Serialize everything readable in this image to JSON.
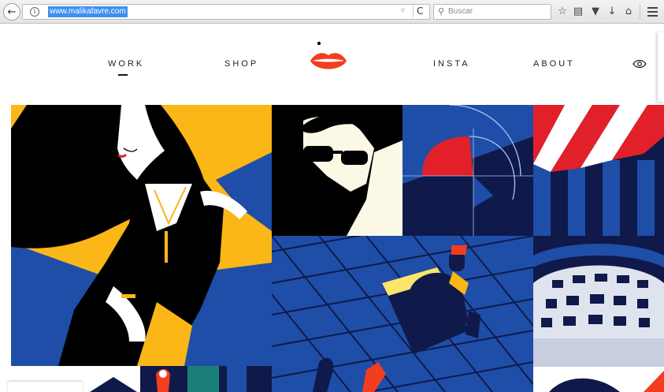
{
  "browser": {
    "url": "www.malikafavre.com",
    "search_placeholder": "Buscar",
    "icons": {
      "back": "back-arrow-icon",
      "info": "info-icon",
      "reload": "reload-icon",
      "search": "search-icon",
      "bookmark": "bookmark-star-icon",
      "reading_list": "reading-list-icon",
      "pocket": "pocket-icon",
      "downloads": "download-icon",
      "home": "home-icon",
      "menu": "hamburger-menu-icon"
    }
  },
  "site": {
    "nav": {
      "work": "WORK",
      "shop": "SHOP",
      "insta": "INSTA",
      "about": "ABOUT"
    },
    "active_nav": "work",
    "logo": "red-lips-logo",
    "colors": {
      "lips": "#f23d1e",
      "navy": "#0f1a4a",
      "royal_blue": "#1f4ea8",
      "yellow": "#fbb617",
      "red": "#e2202a",
      "cream": "#fbf8e6"
    }
  },
  "gallery": {
    "tiles": [
      "illustration-woman-with-dog",
      "illustration-man-sunglasses",
      "illustration-golden-ratio",
      "illustration-striped-awning",
      "illustration-woman-on-bench",
      "illustration-dome-building",
      "illustration-bottom-left-partial",
      "illustration-bottom-middle-partial",
      "illustration-bottom-right-partial"
    ]
  }
}
